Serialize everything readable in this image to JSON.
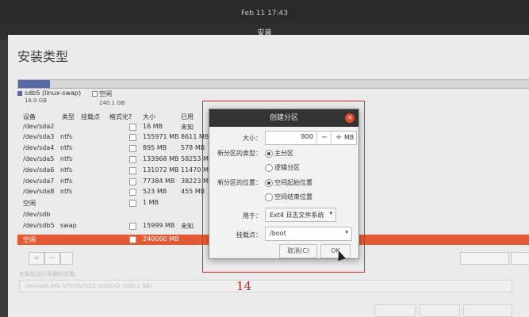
{
  "topbar": {
    "clock": "Feb 11  17:43"
  },
  "window": {
    "title": "安装",
    "heading": "安装类型"
  },
  "disk_bar": {
    "swap_fraction": 0.062,
    "colors": {
      "swap": "#5a6aa8",
      "free": "#d6d6d6",
      "selected": "#e35a35",
      "close": "#e0452a"
    }
  },
  "legend": [
    {
      "name": "sdb5 (linux-swap)",
      "size": "16.0 GB"
    },
    {
      "name": "空闲",
      "size": "240.1 GB"
    }
  ],
  "columns": [
    "设备",
    "类型",
    "挂载点",
    "格式化?",
    "大小",
    "已用"
  ],
  "rows": [
    {
      "device": "/dev/sda2",
      "type": "",
      "mount": "",
      "size": "16 MB",
      "used": "未知"
    },
    {
      "device": "/dev/sda3",
      "type": "ntfs",
      "mount": "",
      "size": "155971 MB",
      "used": "8611 MB"
    },
    {
      "device": "/dev/sda4",
      "type": "ntfs",
      "mount": "",
      "size": "895 MB",
      "used": "578 MB"
    },
    {
      "device": "/dev/sda5",
      "type": "ntfs",
      "mount": "",
      "size": "133968 MB",
      "used": "58253 MB"
    },
    {
      "device": "/dev/sda6",
      "type": "ntfs",
      "mount": "",
      "size": "131072 MB",
      "used": "11470 MB"
    },
    {
      "device": "/dev/sda7",
      "type": "ntfs",
      "mount": "",
      "size": "77384 MB",
      "used": "38223 MB"
    },
    {
      "device": "/dev/sda8",
      "type": "ntfs",
      "mount": "",
      "size": "523 MB",
      "used": "455 MB"
    },
    {
      "device": "空闲",
      "type": "",
      "mount": "",
      "size": "1 MB",
      "used": ""
    },
    {
      "device": "/dev/sdb",
      "type": "",
      "mount": "",
      "size": "",
      "used": ""
    },
    {
      "device": "/dev/sdb5",
      "type": "swap",
      "mount": "",
      "size": "15999 MB",
      "used": "未知"
    },
    {
      "device": "空闲",
      "type": "",
      "mount": "",
      "size": "240060 MB",
      "used": "",
      "selected": true
    }
  ],
  "toolbar": {
    "add": "+",
    "remove": "−"
  },
  "bootloader": {
    "label": "安装启动引导器的设备:",
    "device": "/dev/sda   ATA ST500LT012-1DG142 (500.1 GB)"
  },
  "dialog": {
    "title": "创建分区",
    "close": "×",
    "size_label": "大小：",
    "size_value": "800",
    "minus": "−",
    "plus": "+",
    "unit": "MB",
    "type_label": "新分区的类型：",
    "type_options": [
      {
        "label": "主分区",
        "checked": true
      },
      {
        "label": "逻辑分区",
        "checked": false
      }
    ],
    "location_label": "新分区的位置：",
    "location_options": [
      {
        "label": "空间起始位置",
        "checked": true
      },
      {
        "label": "空间结束位置",
        "checked": false
      }
    ],
    "use_label": "用于：",
    "use_value": "Ext4 日志文件系统",
    "mount_label": "挂载点：",
    "mount_value": "/boot",
    "cancel": "取消(C)",
    "ok": "OK"
  },
  "annotation": "14"
}
